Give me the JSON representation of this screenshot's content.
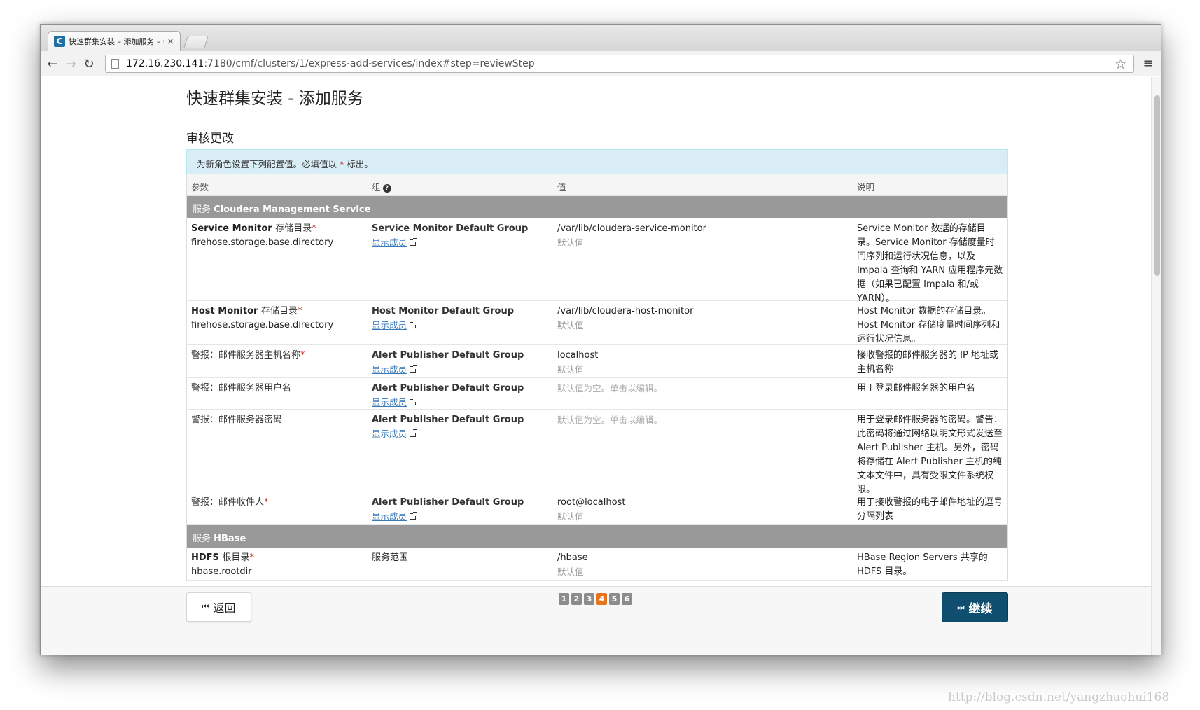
{
  "browser": {
    "tab_title": "快速群集安装 – 添加服务 – C",
    "tab_close": "×",
    "favicon_letter": "C",
    "url_host": "172.16.230.141",
    "url_rest": ":7180/cmf/clusters/1/express-add-services/index#step=reviewStep",
    "back_glyph": "←",
    "forward_glyph": "→",
    "reload_glyph": "↻",
    "star_glyph": "☆",
    "menu_glyph": "≡"
  },
  "page": {
    "title": "快速群集安装 - 添加服务",
    "section_title": "审核更改",
    "notice_prefix": "为新角色设置下列配置值。必填值以",
    "notice_star": "*",
    "notice_suffix": "标出。"
  },
  "table": {
    "headers": {
      "param": "参数",
      "group": "组",
      "value": "值",
      "desc": "说明"
    },
    "help_glyph": "?",
    "show_members": "显示成员",
    "default_label": "默认值",
    "empty_placeholder": "默认值为空。单击以编辑。",
    "required_mark": "*",
    "service_prefix": "服务",
    "services": [
      {
        "name": "Cloudera Management Service",
        "rows": [
          {
            "name_en": "Service Monitor",
            "name_zh": "存储目录",
            "required": true,
            "key": "firehose.storage.base.directory",
            "group": "Service Monitor Default Group",
            "value": "/var/lib/cloudera-service-monitor",
            "desc": "Service Monitor 数据的存储目录。Service Monitor 存储度量时间序列和运行状况信息，以及 Impala 查询和 YARN 应用程序元数据（如果已配置 Impala 和/或 YARN）。"
          },
          {
            "name_en": "Host Monitor",
            "name_zh": "存储目录",
            "required": true,
            "key": "firehose.storage.base.directory",
            "group": "Host Monitor Default Group",
            "value": "/var/lib/cloudera-host-monitor",
            "desc": "Host Monitor 数据的存储目录。Host Monitor 存储度量时间序列和运行状况信息。"
          },
          {
            "name_en": "",
            "name_zh": "警报：邮件服务器主机名称",
            "required": true,
            "key": "",
            "group": "Alert Publisher Default Group",
            "value": "localhost",
            "desc": "接收警报的邮件服务器的 IP 地址或主机名称"
          },
          {
            "name_en": "",
            "name_zh": "警报：邮件服务器用户名",
            "required": false,
            "key": "",
            "group": "Alert Publisher Default Group",
            "value": "",
            "desc": "用于登录邮件服务器的用户名"
          },
          {
            "name_en": "",
            "name_zh": "警报：邮件服务器密码",
            "required": false,
            "key": "",
            "group": "Alert Publisher Default Group",
            "value": "",
            "desc": "用于登录邮件服务器的密码。警告：此密码将通过网络以明文形式发送至 Alert Publisher 主机。另外，密码将存储在 Alert Publisher 主机的纯文本文件中，具有受限文件系统权限。"
          },
          {
            "name_en": "",
            "name_zh": "警报：邮件收件人",
            "required": true,
            "key": "",
            "group": "Alert Publisher Default Group",
            "value": "root@localhost",
            "desc": "用于接收警报的电子邮件地址的逗号分隔列表"
          }
        ]
      },
      {
        "name": "HBase",
        "rows": [
          {
            "name_en": "HDFS",
            "name_zh": "根目录",
            "required": true,
            "key": "hbase.rootdir",
            "group": "服务范围",
            "value": "/hbase",
            "desc": "HBase Region Servers 共享的 HDFS 目录。"
          }
        ]
      }
    ]
  },
  "footer": {
    "back_label": "返回",
    "continue_label": "继续",
    "steps": [
      "1",
      "2",
      "3",
      "4",
      "5",
      "6"
    ],
    "active_step": "4"
  },
  "watermark": "http://blog.csdn.net/yangzhaohui168"
}
